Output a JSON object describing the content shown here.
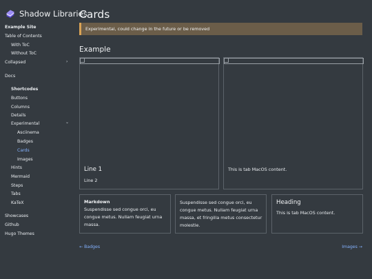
{
  "sidebar": {
    "brand_title": "Shadow Libraries",
    "items": [
      {
        "label": "Example Site"
      },
      {
        "label": "Table of Contents"
      },
      {
        "label": "With ToC"
      },
      {
        "label": "Without ToC"
      },
      {
        "label": "Collapsed"
      },
      {
        "label": "Docs"
      },
      {
        "label": "Shortcodes"
      },
      {
        "label": "Buttons"
      },
      {
        "label": "Columns"
      },
      {
        "label": "Details"
      },
      {
        "label": "Experimental"
      },
      {
        "label": "Asciinema"
      },
      {
        "label": "Badges"
      },
      {
        "label": "Cards"
      },
      {
        "label": "Images"
      },
      {
        "label": "Hints"
      },
      {
        "label": "Mermaid"
      },
      {
        "label": "Steps"
      },
      {
        "label": "Tabs"
      },
      {
        "label": "KaTeX"
      },
      {
        "label": "Showcases"
      },
      {
        "label": "Github"
      },
      {
        "label": "Hugo Themes"
      }
    ],
    "chevron_right": "›",
    "chevron_down": "⌄"
  },
  "main": {
    "title": "Cards",
    "hint": "Experimental, could change in the future or be removed",
    "section_title": "Example",
    "top_cards": [
      {
        "title": "Line 1",
        "text": "Line 2"
      },
      {
        "text": "This is tab MacOS content."
      }
    ],
    "bottom_cards": [
      {
        "strong": "Markdown",
        "lines": [
          "Suspendisse sed congue orci, eu",
          "congue metus. Nullam feugiat urna",
          "massa."
        ]
      },
      {
        "lines": [
          "Suspendisse sed congue orci, eu",
          "congue metus. Nullam feugiat urna",
          "massa, et fringilla metus consectetur",
          "molestie."
        ]
      },
      {
        "heading": "Heading",
        "text": "This is tab MacOS content."
      }
    ]
  },
  "pager": {
    "prev": "← Badges",
    "next": "Images →"
  },
  "colors": {
    "background": "#343a40",
    "accent": "#84b2ff",
    "hint_bg": "#6b5d49",
    "hint_border": "#d9a356",
    "brand_icon": "#9c8cf5"
  }
}
